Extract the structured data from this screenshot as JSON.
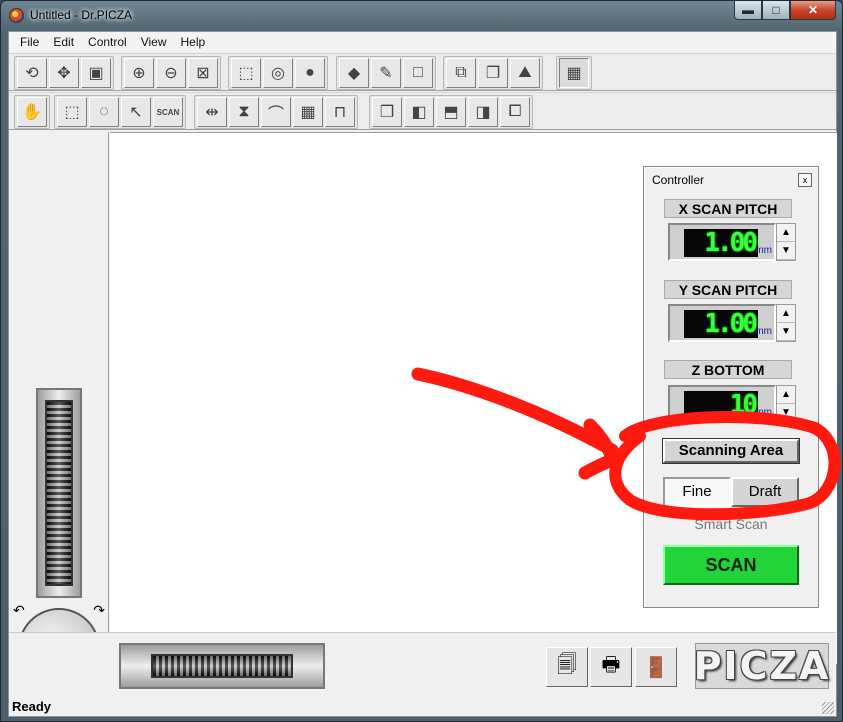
{
  "window": {
    "title": "Untitled - Dr.PICZA",
    "minimize": "▬",
    "maximize": "□",
    "close": "✕"
  },
  "menu": [
    "File",
    "Edit",
    "Control",
    "View",
    "Help"
  ],
  "toolbar1": {
    "groups": [
      [
        "rotate-icon",
        "move-icon",
        "box-view-icon"
      ],
      [
        "zoom-in-icon",
        "zoom-out-icon",
        "zoom-fit-icon"
      ],
      [
        "wireframe-icon",
        "flat-shade-icon",
        "smooth-shade-icon"
      ],
      [
        "paint-bucket-icon",
        "brush-icon",
        "blank-icon"
      ],
      [
        "cube-export-icon",
        "copy-icon",
        "landscape-icon"
      ],
      [
        "remote-icon"
      ]
    ]
  },
  "toolbar2": {
    "groups": [
      [
        "hand-icon"
      ],
      [
        "rect-select-icon",
        "lasso-select-icon",
        "arrow-select-icon",
        "scan-select-icon"
      ],
      [
        "flip-horizontal-icon",
        "mirror-icon",
        "arc-icon",
        "grid-icon",
        "measure-icon"
      ],
      [
        "cube-front-icon",
        "cube-side-icon",
        "cube-top-icon",
        "cube-back-icon",
        "cube-iso-icon"
      ]
    ],
    "scan_text": "SCAN"
  },
  "controller": {
    "title": "Controller",
    "close": "x",
    "x_pitch": {
      "label": "X SCAN PITCH",
      "value": "1.00",
      "unit": "mm"
    },
    "y_pitch": {
      "label": "Y SCAN PITCH",
      "value": "1.00",
      "unit": "mm"
    },
    "z_bottom": {
      "label": "Z BOTTOM",
      "value": "10",
      "unit": "mm"
    },
    "scanning_area": "Scanning Area",
    "fine": "Fine",
    "draft": "Draft",
    "smart_scan": "Smart Scan",
    "scan": "SCAN",
    "spin_up": "▲",
    "spin_down": "▼"
  },
  "bottom": {
    "logo": "PICZA"
  },
  "status": {
    "text": "Ready"
  },
  "colors": {
    "annotation": "#ff1a10",
    "scan_green": "#22d33a",
    "lcd_green": "#35ff38"
  }
}
